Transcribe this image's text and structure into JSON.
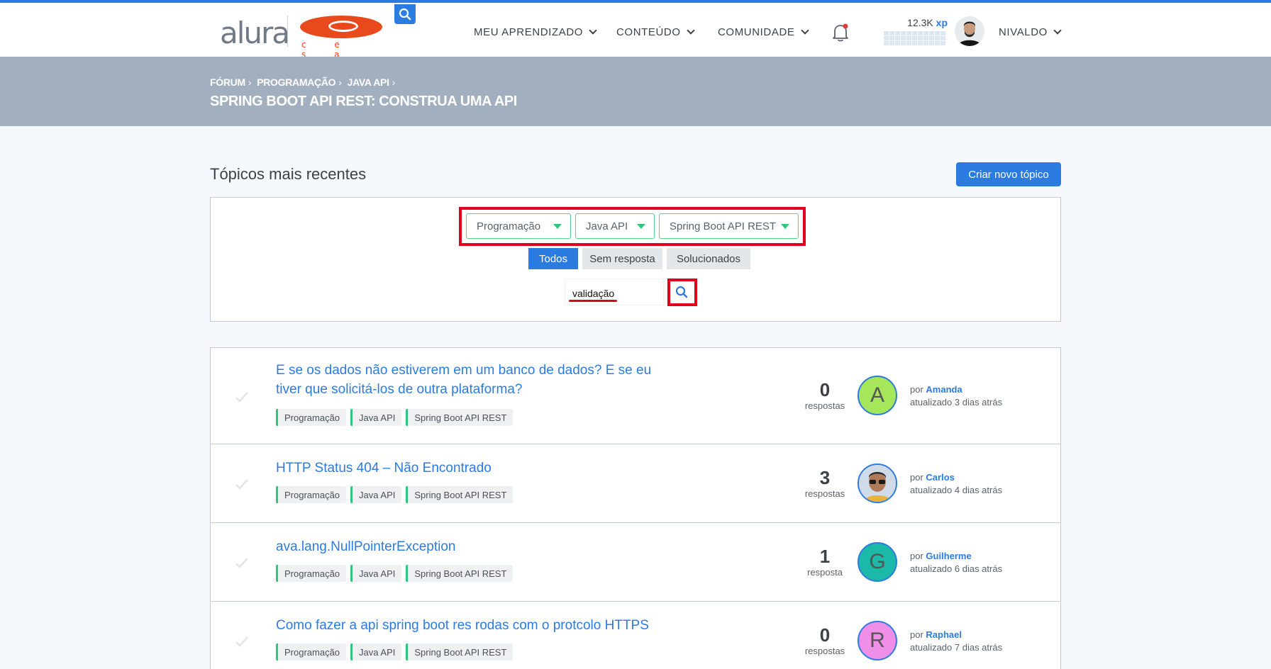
{
  "header": {
    "logo_text": "alura",
    "partner_logo_text": "c e s a r",
    "nav": [
      {
        "label": "MEU APRENDIZADO"
      },
      {
        "label": "CONTEÚDO"
      },
      {
        "label": "COMUNIDADE"
      }
    ],
    "xp_value": "12.3K",
    "xp_unit": "xp",
    "user_name": "NIVALDO"
  },
  "breadcrumb": {
    "items": [
      "FÓRUM",
      "PROGRAMAÇÃO",
      "JAVA API"
    ],
    "separator": "›"
  },
  "page_title": "SPRING BOOT API REST: CONSTRUA UMA API",
  "section_title": "Tópicos mais recentes",
  "new_topic_label": "Criar novo tópico",
  "filters": {
    "selects": [
      "Programação",
      "Java API",
      "Spring Boot API REST"
    ],
    "tabs": [
      "Todos",
      "Sem resposta",
      "Solucionados"
    ],
    "active_tab": "Todos",
    "search_value": "validação"
  },
  "topics": [
    {
      "title": "E se os dados não estiverem em um banco de dados? E se eu tiver que solicitá-los de outra plataforma?",
      "tags": [
        "Programação",
        "Java API",
        "Spring Boot API REST"
      ],
      "count": "0",
      "count_label": "respostas",
      "avatar_letter": "A",
      "avatar_color": "#a5e65a",
      "by": "por",
      "author": "Amanda",
      "updated": "atualizado 3 dias atrás"
    },
    {
      "title": "HTTP Status 404 – Não Encontrado",
      "tags": [
        "Programação",
        "Java API",
        "Spring Boot API REST"
      ],
      "count": "3",
      "count_label": "respostas",
      "avatar_letter": "",
      "avatar_color": "#c9d6e4",
      "by": "por",
      "author": "Carlos",
      "updated": "atualizado 4 dias atrás"
    },
    {
      "title": "ava.lang.NullPointerException",
      "tags": [
        "Programação",
        "Java API",
        "Spring Boot API REST"
      ],
      "count": "1",
      "count_label": "resposta",
      "avatar_letter": "G",
      "avatar_color": "#1cb8a8",
      "by": "por",
      "author": "Guilherme",
      "updated": "atualizado 6 dias atrás"
    },
    {
      "title": "Como fazer a api spring boot res rodas com o protcolo HTTPS",
      "tags": [
        "Programação",
        "Java API",
        "Spring Boot API REST"
      ],
      "count": "0",
      "count_label": "respostas",
      "avatar_letter": "R",
      "avatar_color": "#ef8fe8",
      "by": "por",
      "author": "Raphael",
      "updated": "atualizado 7 dias atrás"
    }
  ],
  "colors": {
    "accent": "#2b7be0",
    "tag_accent": "#2fc57a",
    "highlight": "#e0001b",
    "banner": "#a2afbe"
  }
}
